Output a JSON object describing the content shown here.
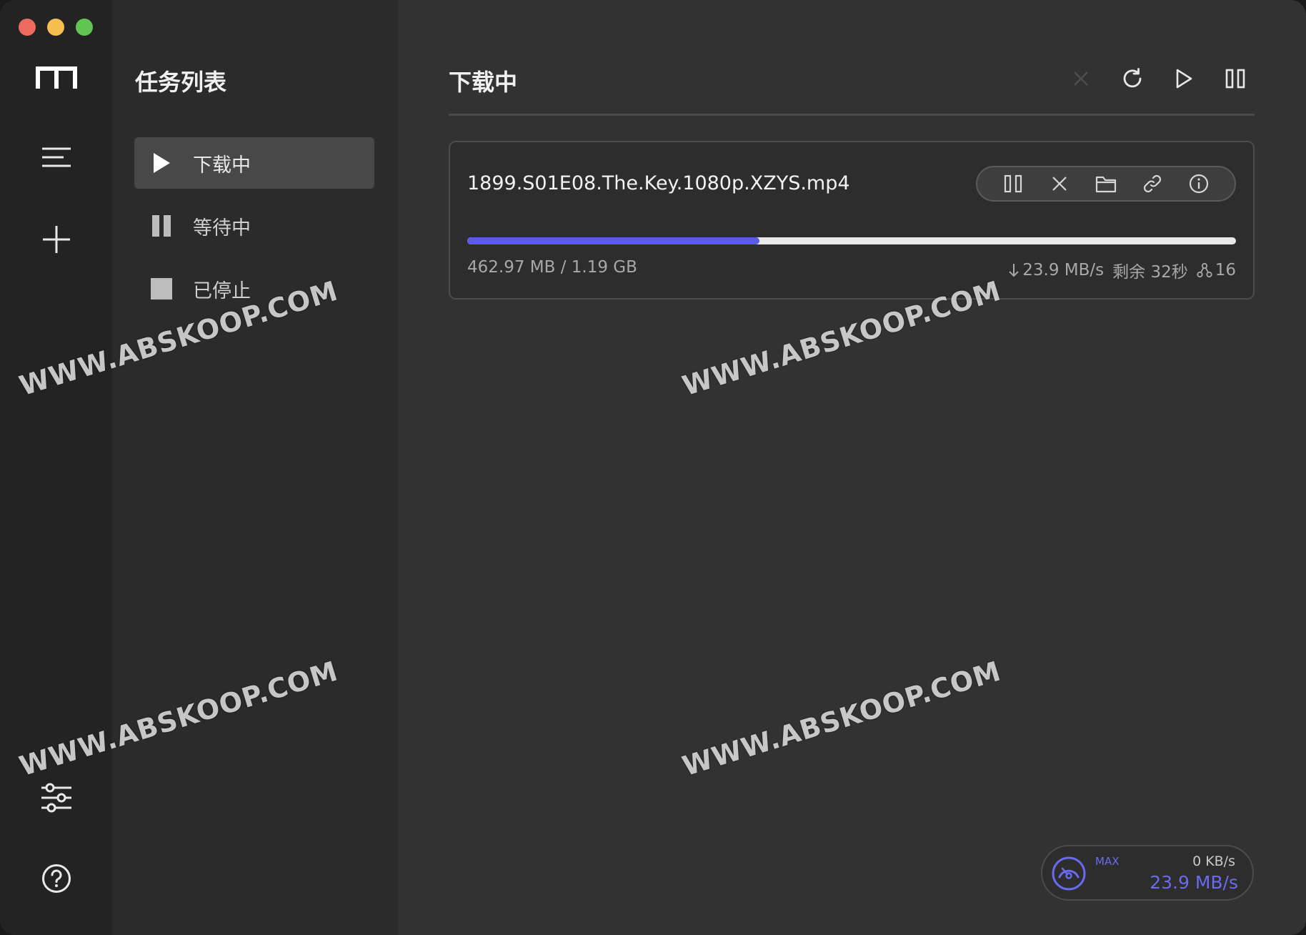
{
  "sidebar": {
    "title": "任务列表",
    "items": [
      {
        "label": "下载中",
        "icon": "play-icon",
        "active": true
      },
      {
        "label": "等待中",
        "icon": "pause-icon",
        "active": false
      },
      {
        "label": "已停止",
        "icon": "stop-icon",
        "active": false
      }
    ]
  },
  "rail": {
    "icons": [
      "app-logo-icon",
      "menu-icon",
      "add-icon",
      "settings-sliders-icon",
      "help-icon"
    ]
  },
  "main": {
    "title": "下载中",
    "toolbar": [
      "close-icon",
      "refresh-icon",
      "play-icon",
      "pause-icon"
    ]
  },
  "task": {
    "name": "1899.S01E08.The.Key.1080p.XZYS.mp4",
    "progress_fraction": 0.38,
    "size_text": "462.97 MB / 1.19 GB",
    "speed_text": "23.9 MB/s",
    "remaining_text": "剩余 32秒",
    "connections_text": "16",
    "actions": [
      "pause-icon",
      "delete-icon",
      "folder-icon",
      "link-icon",
      "info-icon"
    ]
  },
  "speed": {
    "max_label": "MAX",
    "upload": "0 KB/s",
    "download": "23.9 MB/s"
  },
  "colors": {
    "accent": "#5b5be6",
    "rail_bg": "#232323",
    "list_bg": "#2b2b2b",
    "main_bg": "#323232"
  },
  "watermark": "WWW.ABSKOOP.COM"
}
